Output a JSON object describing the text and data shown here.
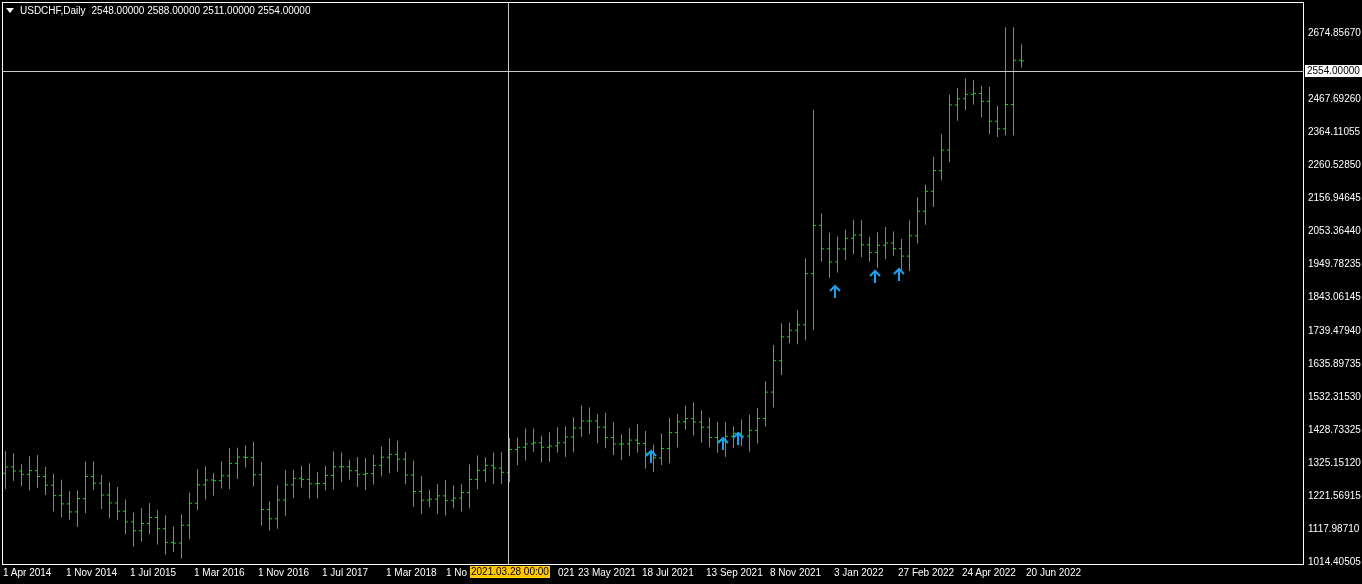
{
  "chart": {
    "symbol": "USDCHF,Daily",
    "ohlc": [
      "2548.00000",
      "2588.00000",
      "2511.00000",
      "2554.00000"
    ],
    "price_axis": [
      "2674.85670",
      "2467.69260",
      "2364.11055",
      "2260.52850",
      "2156.94645",
      "2053.36440",
      "1949.78235",
      "1843.06145",
      "1739.47940",
      "1635.89735",
      "1532.31530",
      "1428.73325",
      "1325.15120",
      "1221.56915",
      "1117.98710",
      "1014.40505"
    ],
    "current_price": "2554.00000",
    "time_axis": [
      "1 Apr 2014",
      "1 Nov 2014",
      "1 Jul 2015",
      "1 Mar 2016",
      "1 Nov 2016",
      "1 Jul 2017",
      "1 Mar 2018",
      "1 No",
      "021",
      "23 May 2021",
      "18 Jul 2021",
      "13 Sep 2021",
      "8 Nov 2021",
      "3 Jan 2022",
      "27 Feb 2022",
      "24 Apr 2022",
      "20 Jun 2022"
    ],
    "crosshair_time": "2021.03.28 00:00"
  }
}
